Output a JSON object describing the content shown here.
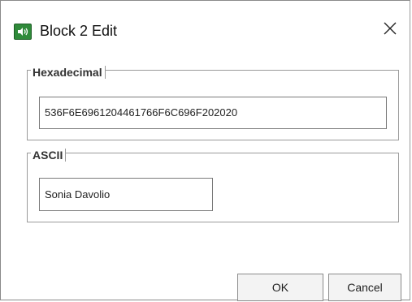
{
  "window": {
    "title": "Block 2 Edit",
    "icon": "speaker-tag-icon",
    "close_icon": "close-icon",
    "accent": "#2f8a3a"
  },
  "hex_group": {
    "label": "Hexadecimal",
    "value": "536F6E6961204461766F6C696F202020"
  },
  "ascii_group": {
    "label": "ASCII",
    "value": "Sonia Davolio"
  },
  "buttons": {
    "ok_label": "OK",
    "cancel_label": "Cancel"
  }
}
